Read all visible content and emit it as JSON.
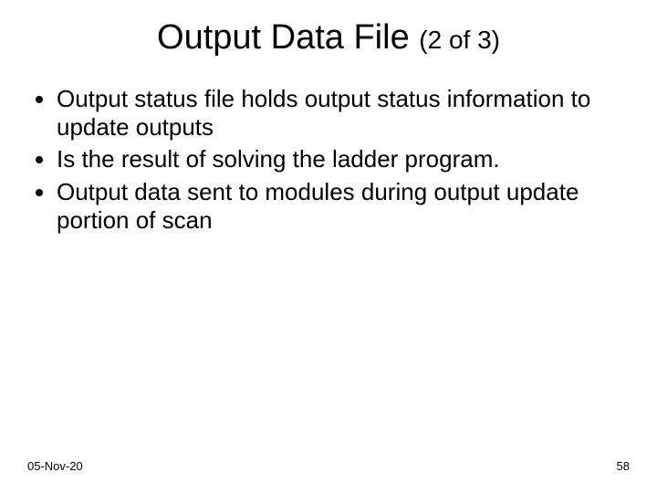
{
  "title_main": "Output Data File ",
  "title_sub": "(2 of 3)",
  "bullets": {
    "b0": "Output status file holds output status information to update outputs",
    "b1": "Is the result of solving the ladder program.",
    "b2": "Output data sent to modules during output update portion of scan"
  },
  "footer": {
    "date": "05-Nov-20",
    "page": "58"
  }
}
